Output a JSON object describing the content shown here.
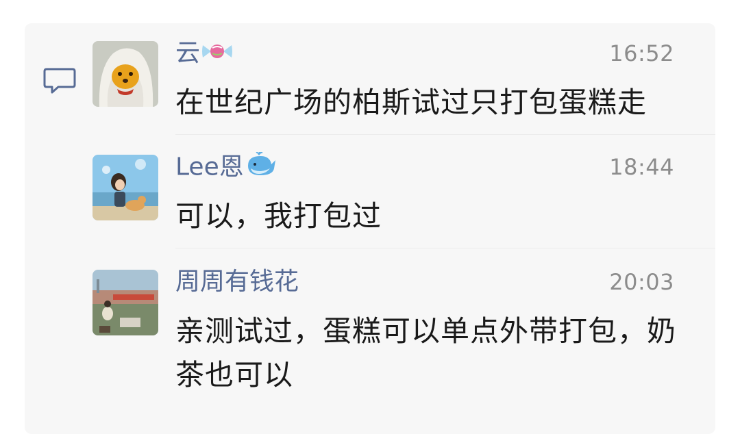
{
  "icons": {
    "comment": "comment-bubble-icon",
    "candy": "candy-emoji-icon",
    "whale": "whale-emoji-icon"
  },
  "colors": {
    "panel_bg": "#f7f7f7",
    "name": "#576b95",
    "time": "#8c8c8c",
    "text": "#1a1a1a"
  },
  "comments": [
    {
      "name": "云",
      "emoji": "candy-emoji-icon",
      "time": "16:52",
      "text": "在世纪广场的柏斯试过只打包蛋糕走"
    },
    {
      "name": "Lee恩",
      "emoji": "whale-emoji-icon",
      "time": "18:44",
      "text": "可以，我打包过"
    },
    {
      "name": "周周有钱花",
      "time": "20:03",
      "text": "亲测试过，蛋糕可以单点外带打包，奶茶也可以"
    }
  ]
}
